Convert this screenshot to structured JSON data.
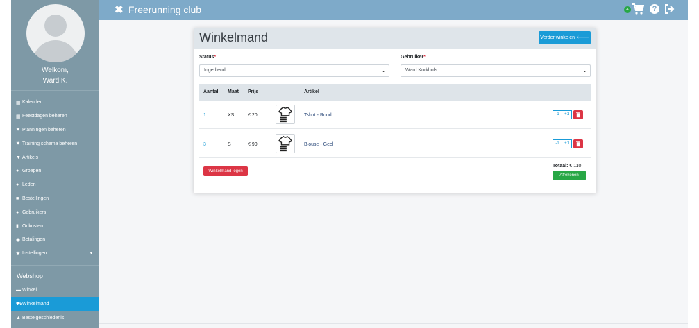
{
  "app": {
    "title": "Freerunning club",
    "cart_count": "4"
  },
  "sidebar": {
    "welcome_line1": "Welkom,",
    "welcome_line2": "Ward K.",
    "items": [
      {
        "icon": "calendar-icon",
        "glyph": "▦",
        "label": "Kalender"
      },
      {
        "icon": "calendar-icon",
        "glyph": "▦",
        "label": "Feestdagen beheren"
      },
      {
        "icon": "tools-icon",
        "glyph": "✖",
        "label": "Planningen beheren"
      },
      {
        "icon": "tools-icon",
        "glyph": "✖",
        "label": "Training schema beheren"
      },
      {
        "icon": "tshirt-icon",
        "glyph": "▼",
        "label": "Artikels"
      },
      {
        "icon": "users-icon",
        "glyph": "●",
        "label": "Groepen"
      },
      {
        "icon": "users-icon",
        "glyph": "●",
        "label": "Leden"
      },
      {
        "icon": "truck-icon",
        "glyph": "■",
        "label": "Bestellingen"
      },
      {
        "icon": "users-icon",
        "glyph": "●",
        "label": "Gebruikers"
      },
      {
        "icon": "file-icon",
        "glyph": "▮",
        "label": "Onkosten"
      },
      {
        "icon": "money-icon",
        "glyph": "◉",
        "label": "Betalingen"
      },
      {
        "icon": "cogs-icon",
        "glyph": "✱",
        "label": "Instellingen",
        "caret": "▾"
      }
    ],
    "webshop_title": "Webshop",
    "shop_items": [
      {
        "icon": "store-icon",
        "glyph": "▬",
        "label": "Winkel"
      },
      {
        "icon": "cart-icon",
        "glyph": "⛟",
        "label": "Winkelmand",
        "active": true
      },
      {
        "icon": "bag-icon",
        "glyph": "▲",
        "label": "Bestelgeschiedenis"
      }
    ]
  },
  "card": {
    "title": "Winkelmand",
    "continue_label": "Verder winkelen",
    "status_label": "Status",
    "status_value": "Ingediend",
    "user_label": "Gebruiker",
    "user_value": "Ward Korkhofs",
    "columns": [
      "Aantal",
      "Maat",
      "Prijs",
      "Artikel"
    ],
    "rows": [
      {
        "qty": "1",
        "size": "XS",
        "price": "€ 20",
        "article": "Tshirt - Rood",
        "minus": "-1",
        "plus": "+1"
      },
      {
        "qty": "3",
        "size": "S",
        "price": "€ 90",
        "article": "Blouse - Geel",
        "minus": "-1",
        "plus": "+1"
      }
    ],
    "empty_label": "Winkelmand legen",
    "total_label": "Totaal:",
    "total_value": "€ 110",
    "checkout_label": "Afrekenen"
  },
  "colors": {
    "sidebar": "#7e99a6",
    "topbar": "#7eaac9",
    "accent": "#1a9bd7",
    "danger": "#dc3545",
    "success": "#28a745"
  }
}
